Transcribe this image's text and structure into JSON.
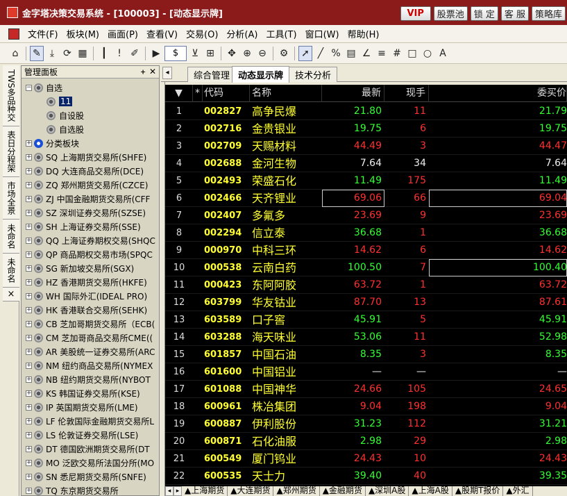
{
  "window": {
    "title": "金字塔决策交易系统 - [100003] - [动态显示牌]",
    "buttons": [
      "VIP",
      "股票池",
      "锁 定",
      "客 服",
      "策略库"
    ]
  },
  "menu": [
    "文件(F)",
    "板块(M)",
    "画面(P)",
    "查看(V)",
    "交易(O)",
    "分析(A)",
    "工具(T)",
    "窗口(W)",
    "帮助(H)"
  ],
  "toolbar": {
    "currency_select": "$",
    "icons": [
      "home-icon",
      "edit-icon",
      "download-icon",
      "sync-icon",
      "grid-icon",
      "bar-chart-icon",
      "alert-icon",
      "pencil-icon",
      "play-icon",
      "currency-icon",
      "filter-icon",
      "calculator-icon",
      "move-icon",
      "zoom-in-icon",
      "zoom-out-icon",
      "settings-icon",
      "cursor-icon",
      "line-icon",
      "percent-icon",
      "ruler-icon",
      "brush-icon",
      "channel-icon",
      "hash-icon",
      "rectangle-icon",
      "circle-icon",
      "text-icon"
    ]
  },
  "vtabs": [
    "TWS多品种交",
    "表日分程架",
    "市场全景",
    "未命名",
    "未命名",
    "×"
  ],
  "panel": {
    "title": "管理面板",
    "tree": [
      {
        "label": "自选",
        "expanded": true,
        "icon": "gear",
        "children": [
          {
            "label": "11",
            "selected": true
          },
          {
            "label": "自设股"
          },
          {
            "label": "自选股"
          }
        ]
      },
      {
        "label": "分类板块",
        "icon": "blue"
      },
      {
        "label": "SQ 上海期货交易所(SHFE)"
      },
      {
        "label": "DQ 大连商品交易所(DCE)"
      },
      {
        "label": "ZQ 郑州期货交易所(CZCE)"
      },
      {
        "label": "ZJ 中国金融期货交易所(CFF"
      },
      {
        "label": "SZ 深圳证券交易所(SZSE)"
      },
      {
        "label": "SH 上海证券交易所(SSE)"
      },
      {
        "label": "QQ 上海证券期权交易(SHQC"
      },
      {
        "label": "QP 商品期权交易市场(SPQC"
      },
      {
        "label": "SG 新加坡交易所(SGX)"
      },
      {
        "label": "HZ 香港期货交易所(HKFE)"
      },
      {
        "label": "WH 国际外汇(IDEAL PRO)"
      },
      {
        "label": "HK 香港联合交易所(SEHK)"
      },
      {
        "label": "CB 芝加哥期货交易所（ECB("
      },
      {
        "label": "CM 芝加哥商品交易所CME(("
      },
      {
        "label": "AR 美股统一证券交易所(ARC"
      },
      {
        "label": "NM 纽约商品交易所(NYMEX"
      },
      {
        "label": "NB 纽约期货交易所(NYBOT"
      },
      {
        "label": "KS 韩国证券交易所(KSE)"
      },
      {
        "label": "IP 英国期货交易所(LME)"
      },
      {
        "label": "LF 伦敦国际金融期货交易所L"
      },
      {
        "label": "LS 伦敦证券交易所(LSE)"
      },
      {
        "label": "DT 德国欧洲期货交易所(DT"
      },
      {
        "label": "MO 泛欧交易所法国分所(MO"
      },
      {
        "label": "SN 悉尼期货交易所(SNFE)"
      },
      {
        "label": "TQ 东京期货交易所"
      }
    ]
  },
  "tabs": [
    "综合管理",
    "动态显示牌",
    "技术分析"
  ],
  "table": {
    "headers": [
      "",
      "*",
      "代码",
      "名称",
      "最新",
      "现手",
      "委买价"
    ],
    "rows": [
      [
        "1",
        "002827",
        "高争民爆",
        "21.80",
        "11",
        "21.79",
        "down"
      ],
      [
        "2",
        "002716",
        "金贵银业",
        "19.75",
        "6",
        "19.75",
        "down"
      ],
      [
        "3",
        "002709",
        "天赐材料",
        "44.49",
        "3",
        "44.47",
        "up"
      ],
      [
        "4",
        "002688",
        "金河生物",
        "7.64",
        "34",
        "7.64",
        "flat"
      ],
      [
        "5",
        "002493",
        "荣盛石化",
        "11.49",
        "175",
        "11.49",
        "down"
      ],
      [
        "6",
        "002466",
        "天齐锂业",
        "69.06",
        "66",
        "69.04",
        "up"
      ],
      [
        "7",
        "002407",
        "多氟多",
        "23.69",
        "9",
        "23.69",
        "up"
      ],
      [
        "8",
        "002294",
        "信立泰",
        "36.68",
        "1",
        "36.68",
        "down"
      ],
      [
        "9",
        "000970",
        "中科三环",
        "14.62",
        "6",
        "14.62",
        "up"
      ],
      [
        "10",
        "000538",
        "云南白药",
        "100.50",
        "7",
        "100.40",
        "down"
      ],
      [
        "11",
        "000423",
        "东阿阿胶",
        "63.72",
        "1",
        "63.72",
        "up"
      ],
      [
        "12",
        "603799",
        "华友钴业",
        "87.70",
        "13",
        "87.61",
        "up"
      ],
      [
        "13",
        "603589",
        "口子窖",
        "45.91",
        "5",
        "45.91",
        "down"
      ],
      [
        "14",
        "603288",
        "海天味业",
        "53.06",
        "11",
        "52.98",
        "down"
      ],
      [
        "15",
        "601857",
        "中国石油",
        "8.35",
        "3",
        "8.35",
        "down"
      ],
      [
        "16",
        "601600",
        "中国铝业",
        "—",
        "—",
        "—",
        "flat"
      ],
      [
        "17",
        "601088",
        "中国神华",
        "24.66",
        "105",
        "24.65",
        "up"
      ],
      [
        "18",
        "600961",
        "株冶集团",
        "9.04",
        "198",
        "9.04",
        "up"
      ],
      [
        "19",
        "600887",
        "伊利股份",
        "31.23",
        "112",
        "31.21",
        "down"
      ],
      [
        "20",
        "600871",
        "石化油服",
        "2.98",
        "29",
        "2.98",
        "down"
      ],
      [
        "21",
        "600549",
        "厦门钨业",
        "24.43",
        "10",
        "24.43",
        "up"
      ],
      [
        "22",
        "600535",
        "天士力",
        "39.40",
        "40",
        "39.35",
        "down"
      ]
    ]
  },
  "sheets": [
    "▲上海期货",
    "▲大连期货",
    "▲郑州期货",
    "▲金融期货",
    "▲深圳A股",
    "▲上海A股",
    "▲股期T报价",
    "▲外汇"
  ]
}
